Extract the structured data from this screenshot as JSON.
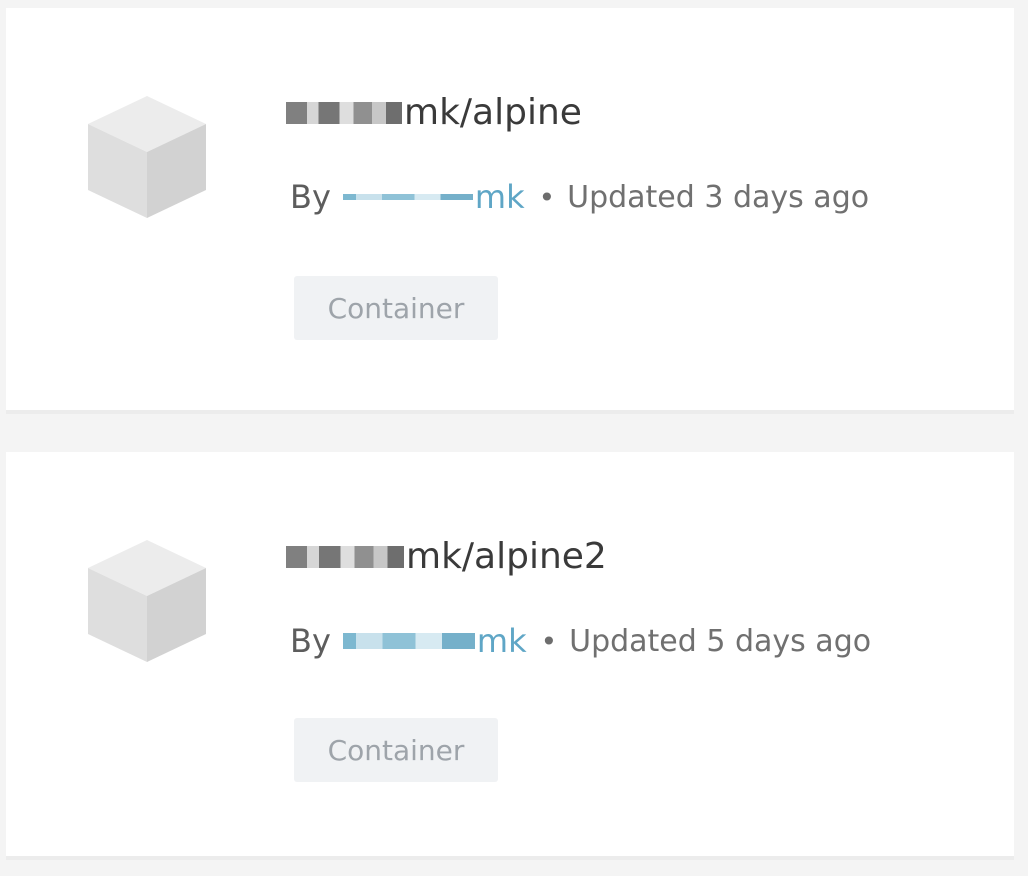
{
  "repositories": [
    {
      "name_suffix": "mk/alpine",
      "by_label": "By",
      "owner_suffix": "mk",
      "separator": "•",
      "updated": "Updated 3 days ago",
      "badge": "Container",
      "icon": "cube-icon"
    },
    {
      "name_suffix": "mk/alpine2",
      "by_label": "By",
      "owner_suffix": "mk",
      "separator": "•",
      "updated": "Updated 5 days ago",
      "badge": "Container",
      "icon": "cube-icon"
    }
  ],
  "colors": {
    "link": "#5fa6c6",
    "title": "#3a3a3a",
    "badge_bg": "#f0f2f4",
    "badge_text": "#9ea4aa",
    "page_bg": "#f4f4f4"
  }
}
